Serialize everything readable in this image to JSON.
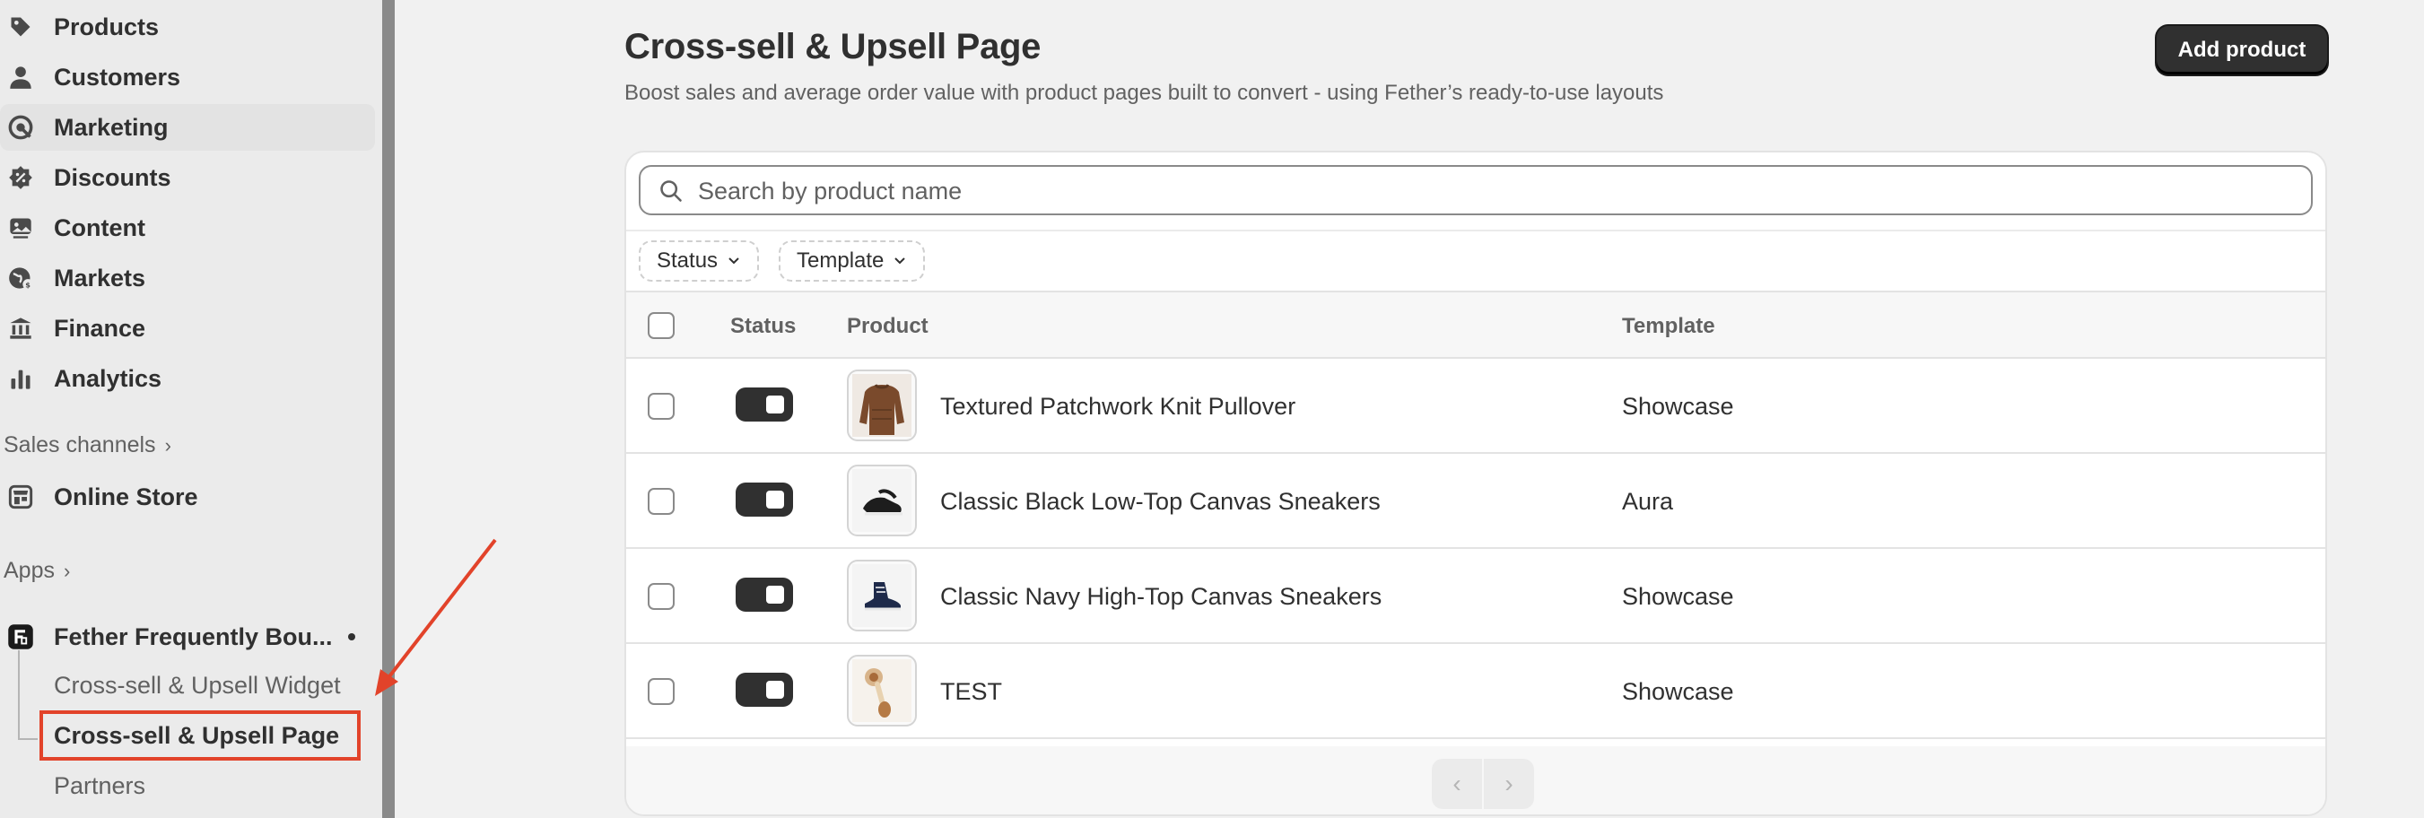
{
  "sidebar": {
    "items": [
      {
        "label": "Products",
        "icon": "tag-icon"
      },
      {
        "label": "Customers",
        "icon": "person-icon"
      },
      {
        "label": "Marketing",
        "icon": "target-icon"
      },
      {
        "label": "Discounts",
        "icon": "discount-badge-icon"
      },
      {
        "label": "Content",
        "icon": "image-icon"
      },
      {
        "label": "Markets",
        "icon": "globe-icon"
      },
      {
        "label": "Finance",
        "icon": "bank-icon"
      },
      {
        "label": "Analytics",
        "icon": "bar-chart-icon"
      }
    ],
    "sales_channels_label": "Sales channels",
    "online_store_label": "Online Store",
    "apps_label": "Apps",
    "app_name": "Fether Frequently Bou...",
    "app_subitems": [
      "Cross-sell & Upsell Widget",
      "Cross-sell & Upsell Page"
    ],
    "partners_label": "Partners"
  },
  "header": {
    "title": "Cross-sell & Upsell Page",
    "subtitle": "Boost sales and average order value with product pages built to convert - using Fether’s ready-to-use layouts",
    "add_button": "Add product"
  },
  "search": {
    "placeholder": "Search by product name"
  },
  "filters": [
    "Status",
    "Template"
  ],
  "table": {
    "columns": [
      "Status",
      "Product",
      "Template"
    ],
    "rows": [
      {
        "product": "Textured Patchwork Knit Pullover",
        "template": "Showcase",
        "enabled": true
      },
      {
        "product": "Classic Black Low-Top Canvas Sneakers",
        "template": "Aura",
        "enabled": true
      },
      {
        "product": "Classic Navy High-Top Canvas Sneakers",
        "template": "Showcase",
        "enabled": true
      },
      {
        "product": "TEST",
        "template": "Showcase",
        "enabled": true
      }
    ]
  },
  "colors": {
    "highlight": "#e2432a",
    "primary": "#303030"
  }
}
